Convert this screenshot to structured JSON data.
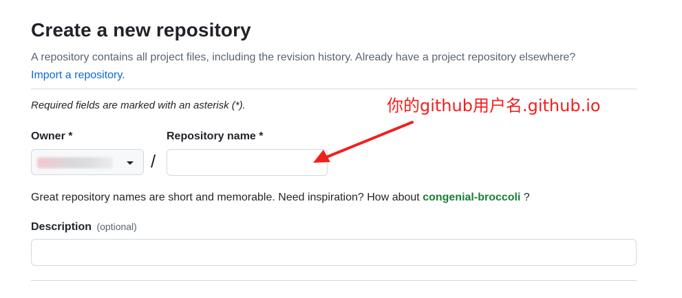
{
  "header": {
    "title": "Create a new repository",
    "subtitle": "A repository contains all project files, including the revision history. Already have a project repository elsewhere?",
    "import_link": "Import a repository."
  },
  "form": {
    "required_note": "Required fields are marked with an asterisk (*).",
    "owner_label": "Owner *",
    "owner_value": "",
    "separator": "/",
    "repo_name_label": "Repository name *",
    "repo_name_value": "",
    "hint_prefix": "Great repository names are short and memorable. Need inspiration? How about",
    "hint_suggestion": "congenial-broccoli",
    "hint_suffix": "?",
    "description_label": "Description",
    "description_optional": "(optional)",
    "description_value": ""
  },
  "annotation": {
    "text": "你的github用户名.github.io",
    "color": "#f0201d"
  },
  "colors": {
    "link": "#0969da",
    "suggestion": "#1a7f37",
    "muted_text": "#59636e",
    "border": "#d1d9e0"
  },
  "icons": {
    "owner_dropdown": "caret-down-icon",
    "annotation_arrow": "arrow-icon"
  }
}
